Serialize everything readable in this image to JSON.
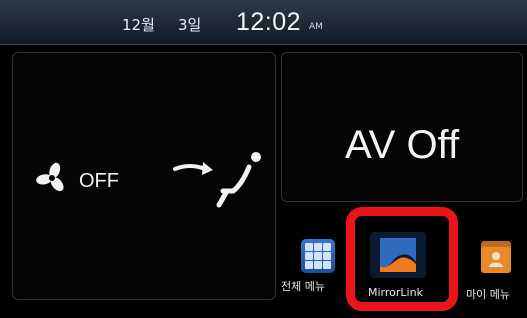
{
  "status_bar": {
    "month": "12월",
    "day": "3일",
    "time": "12:02",
    "ampm": "AM"
  },
  "climate": {
    "fan_status": "OFF",
    "fan_icon": "fan-icon",
    "airflow_icon": "seat-airflow-icon"
  },
  "av": {
    "status": "AV Off"
  },
  "launcher": {
    "apps": [
      {
        "label": "전체 메뉴",
        "icon": "grid-menu-icon"
      },
      {
        "label": "MirrorLink",
        "icon": "mirrorlink-icon"
      },
      {
        "label": "마이 메뉴",
        "icon": "folder-icon"
      }
    ]
  },
  "colors": {
    "highlight": "#e8161b",
    "status_bar": "#1c2734",
    "accent_blue": "#2f6bbf",
    "mirror_orange": "#f07a1a"
  }
}
